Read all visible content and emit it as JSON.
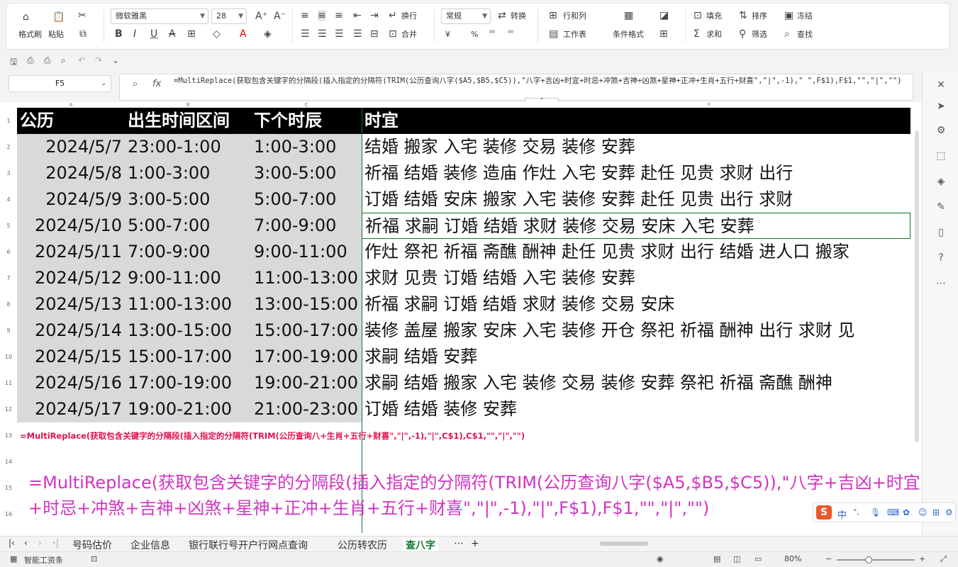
{
  "ribbon": {
    "format_painter": "格式刷",
    "paste": "粘贴",
    "font_name": "微软雅黑",
    "font_size": "28",
    "wrap": "换行",
    "merge": "合并",
    "number_format": "常规",
    "convert": "转换",
    "row_col": "行和列",
    "worksheet": "工作表",
    "cond_format": "条件格式",
    "fill": "填充",
    "sort": "排序",
    "freeze": "冻结",
    "sum": "求和",
    "filter": "筛选",
    "find": "查找",
    "currency": "¥",
    "percent": "%"
  },
  "formula_bar": {
    "name_box": "F5",
    "fx": "fx",
    "formula": "=MultiReplace(获取包含关键字的分隔段(插入指定的分隔符(TRIM(公历查询八字($A5,$B5,$C5)),\"八字+吉凶+时宜+时忌+冲煞+吉神+凶煞+星神+正冲+生肖+五行+财喜\",\"|\",-1),\" \",F$1),F$1,\"\",\"|\",\"\")"
  },
  "columns": [
    "A",
    "B",
    "C",
    "F"
  ],
  "table": {
    "headers": [
      "公历",
      "出生时间区间",
      "下个时辰",
      "时宜"
    ],
    "rows": [
      [
        "2024/5/7",
        "23:00-1:00",
        "1:00-3:00",
        "结婚 搬家 入宅 装修 交易 装修 安葬"
      ],
      [
        "2024/5/8",
        "1:00-3:00",
        "3:00-5:00",
        "祈福 结婚 装修 造庙 作灶 入宅 安葬 赴任 见贵 求财 出行"
      ],
      [
        "2024/5/9",
        "3:00-5:00",
        "5:00-7:00",
        "订婚 结婚 安床 搬家 入宅 装修 安葬 赴任 见贵 出行 求财"
      ],
      [
        "2024/5/10",
        "5:00-7:00",
        "7:00-9:00",
        "祈福 求嗣 订婚 结婚 求财 装修 交易 安床 入宅 安葬"
      ],
      [
        "2024/5/11",
        "7:00-9:00",
        "9:00-11:00",
        "作灶 祭祀 祈福 斋醮 酬神 赴任 见贵 求财 出行 结婚 进人口 搬家"
      ],
      [
        "2024/5/12",
        "9:00-11:00",
        "11:00-13:00",
        "求财 见贵 订婚 结婚 入宅 装修 安葬"
      ],
      [
        "2024/5/13",
        "11:00-13:00",
        "13:00-15:00",
        "祈福 求嗣 订婚 结婚 求财 装修 交易 安床"
      ],
      [
        "2024/5/14",
        "13:00-15:00",
        "15:00-17:00",
        "装修 盖屋 搬家 安床 入宅 装修 开仓 祭祀 祈福 酬神 出行 求财 见"
      ],
      [
        "2024/5/15",
        "15:00-17:00",
        "17:00-19:00",
        "求嗣 结婚 安葬"
      ],
      [
        "2024/5/16",
        "17:00-19:00",
        "19:00-21:00",
        "求嗣 结婚 搬家 入宅 装修 交易 装修 安葬 祭祀 祈福 斋醮 酬神"
      ],
      [
        "2024/5/17",
        "19:00-21:00",
        "21:00-23:00",
        "订婚 结婚 装修 安葬"
      ]
    ]
  },
  "row_numbers": [
    "1",
    "2",
    "3",
    "4",
    "5",
    "6",
    "7",
    "8",
    "9",
    "10",
    "11",
    "12",
    "13",
    "14",
    "15",
    "16"
  ],
  "row13_formula": "=MultiReplace(获取包含关键字的分隔段(插入指定的分隔符(TRIM(公历查询八​+生肖+五行+财喜\",\"|\",-1),\"|\",C$1),C$1,\"\",\"|\",\"\")",
  "big_formula": "=MultiReplace(获取包含关键字的分隔段(插入指定的分隔符(TRIM(公历查询八字($A5,$B5,$C5)),\"八字+吉凶+时宜+时忌+冲煞+吉神+凶煞+星神+正冲+生肖+五行+财喜\",\"|\",-1),\"|\",F$1),F$1,\"\",\"|\",\"\")",
  "sheet_tabs": [
    "号码估价",
    "企业信息",
    "银行联行号开户行网点查询",
    "公历转农历",
    "查八字"
  ],
  "active_tab": "查八字",
  "status": {
    "app": "智能工资条",
    "zoom": "80%"
  },
  "ime": {
    "lang": "中"
  },
  "colors": {
    "accent": "#127a2e",
    "formula_red": "#e0124f",
    "formula_magenta": "#d233c2"
  }
}
